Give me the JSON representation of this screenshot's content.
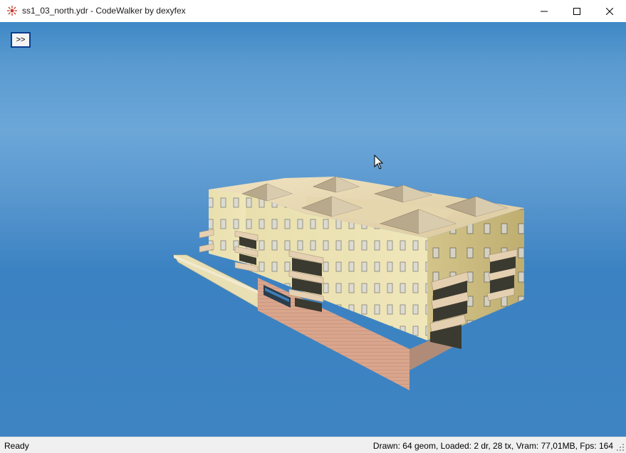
{
  "window": {
    "title": "ss1_03_north.ydr - CodeWalker by dexyfex",
    "icon": "codewalker-app-icon",
    "controls": [
      "minimize-icon",
      "maximize-icon",
      "close-icon"
    ]
  },
  "toolbar": {
    "toggle_label": ">>"
  },
  "viewport": {
    "background_color": "#4a8fcb",
    "model": "building-3d-model"
  },
  "statusbar": {
    "left_text": "Ready",
    "right_text": "Drawn: 64 geom, Loaded: 2 dr, 28 tx, Vram: 77,01MB, Fps: 164"
  }
}
